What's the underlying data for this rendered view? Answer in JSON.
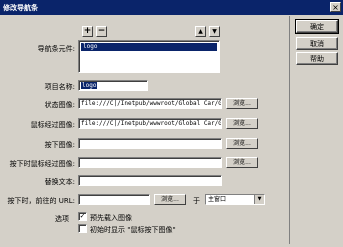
{
  "window": {
    "title": "修改导航条",
    "close_glyph": "×"
  },
  "buttons": {
    "ok": "确定",
    "cancel": "取消",
    "help": "帮助"
  },
  "toolbar": {
    "add": "+",
    "remove": "−",
    "up": "▲",
    "down": "▼"
  },
  "nav_elements": {
    "label": "导航条元件:",
    "items": [
      "logo"
    ]
  },
  "item_name": {
    "label": "项目名称:",
    "value": "logo"
  },
  "state_image": {
    "label": "状态图像:",
    "value": "file:///C|/Inetpub/wwwroot/Global Car/Ge",
    "browse": "浏览..."
  },
  "rollover_image": {
    "label": "鼠标经过图像:",
    "value": "file:///C|/Inetpub/wwwroot/Global Car/Ge",
    "browse": "浏览..."
  },
  "down_image": {
    "label": "按下图像:",
    "value": "",
    "browse": "浏览..."
  },
  "over_down_image": {
    "label": "按下时鼠标经过图像:",
    "value": "",
    "browse": "浏览..."
  },
  "alt_text": {
    "label": "替换文本:",
    "value": ""
  },
  "when_clicked": {
    "label": "按下时，前往的 URL:",
    "value": "",
    "browse": "浏览...",
    "in_label": "于",
    "target": "主窗口"
  },
  "options": {
    "label": "选项",
    "preload": {
      "label": "预先载入图像",
      "checked": true,
      "mark": "✓"
    },
    "show_down": {
      "label": "初始时显示 \"鼠标按下图像\"",
      "checked": false,
      "mark": ""
    }
  }
}
